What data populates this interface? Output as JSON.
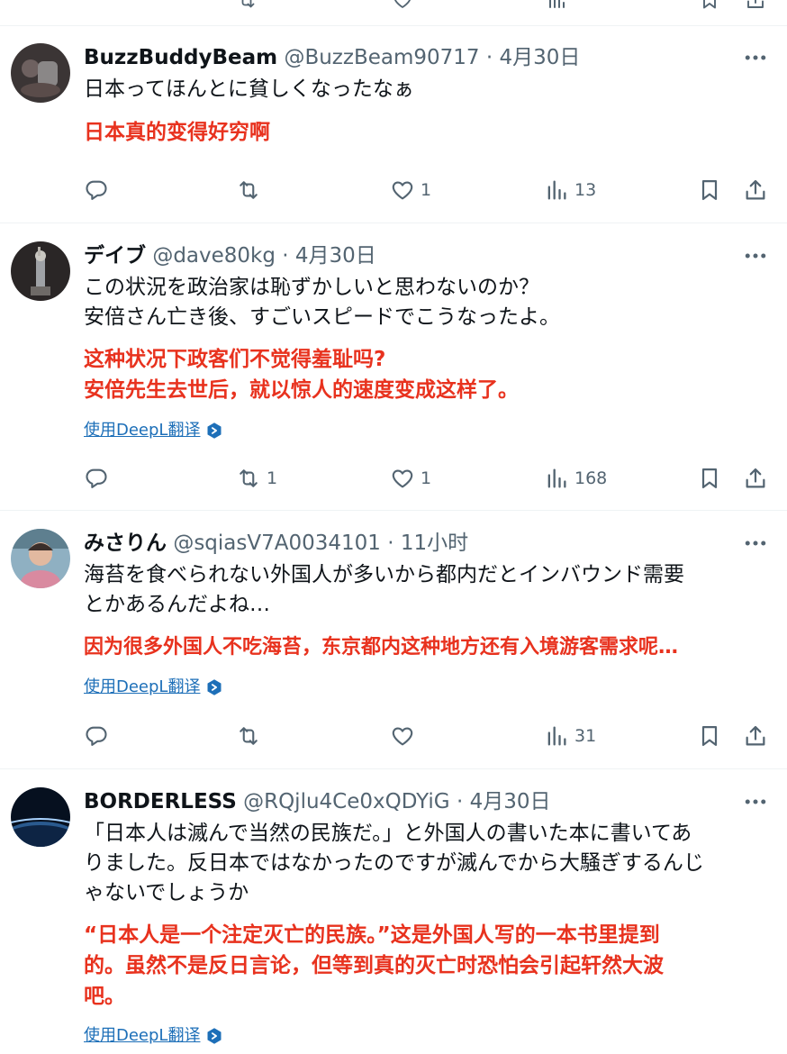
{
  "tweets": [
    {
      "name": "BuzzBuddyBeam",
      "handle": "@BuzzBeam90717",
      "sep": "·",
      "time": "4月30日",
      "text": "日本ってほんとに貧しくなったなぁ",
      "translation": "日本真的变得好穷啊",
      "deepl": "",
      "replies": "",
      "retweets": "",
      "likes": "1",
      "views": "13"
    },
    {
      "name": "デイブ",
      "handle": "@dave80kg",
      "sep": "·",
      "time": "4月30日",
      "text": "この状況を政治家は恥ずかしいと思わないのか？\n安倍さん亡き後、すごいスピードでこうなったよ。",
      "translation": "这种状况下政客们不觉得羞耻吗?\n安倍先生去世后，就以惊人的速度变成这样了。",
      "deepl": "使用DeepL翻译",
      "replies": "",
      "retweets": "1",
      "likes": "1",
      "views": "168"
    },
    {
      "name": "みさりん",
      "handle": "@sqiasV7A0034101",
      "sep": "·",
      "time": "11小时",
      "text": "海苔を食べられない外国人が多いから都内だとインバウンド需要\nとかあるんだよね…",
      "translation": "因为很多外国人不吃海苔，东京都内这种地方还有入境游客需求呢…",
      "deepl": "使用DeepL翻译",
      "replies": "",
      "retweets": "",
      "likes": "",
      "views": "31"
    },
    {
      "name": "BORDERLESS",
      "handle": "@RQjlu4Ce0xQDYiG",
      "sep": "·",
      "time": "4月30日",
      "text": "「日本人は滅んで当然の民族だ。」と外国人の書いた本に書いてあ\nりました。反日本ではなかったのですが滅んでから大騒ぎするんじ\nゃないでしょうか",
      "translation": "“日本人是一个注定灭亡的民族。”这是外国人写的一本书里提到\n的。虽然不是反日言论，但等到真的灭亡时恐怕会引起轩然大波\n吧。",
      "deepl": "使用DeepL翻译"
    }
  ],
  "colors": {
    "translation": "#e8321e",
    "link": "#1d6fb8",
    "secondary": "#536471"
  }
}
